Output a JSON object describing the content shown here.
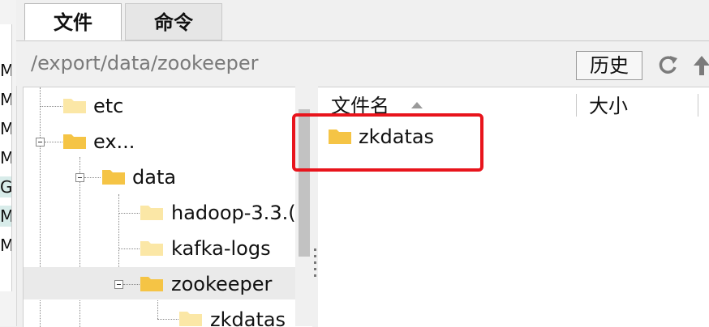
{
  "left_strip": {
    "letters": [
      "M",
      "M",
      "M",
      "M",
      "G",
      "M",
      "M"
    ]
  },
  "tabs": [
    {
      "label": "文件",
      "active": true
    },
    {
      "label": "命令",
      "active": false
    }
  ],
  "path": {
    "value": "/export/data/zookeeper",
    "history_label": "历史"
  },
  "tree": {
    "nodes": [
      {
        "label": "etc"
      },
      {
        "label": "ex..."
      },
      {
        "label": "data"
      },
      {
        "label": "hadoop-3.3.("
      },
      {
        "label": "kafka-logs"
      },
      {
        "label": "zookeeper"
      },
      {
        "label": "zkdatas"
      }
    ]
  },
  "file_list": {
    "columns": {
      "name": "文件名",
      "size": "大小"
    },
    "rows": [
      {
        "name": "zkdatas"
      }
    ]
  },
  "colors": {
    "highlight": "#e8141c",
    "folder": "#f5c445",
    "folder_light": "#fbe7a6"
  },
  "icons": [
    "refresh-icon",
    "up-arrow-icon",
    "folder-icon",
    "sort-ascending-icon",
    "collapse-icon"
  ]
}
